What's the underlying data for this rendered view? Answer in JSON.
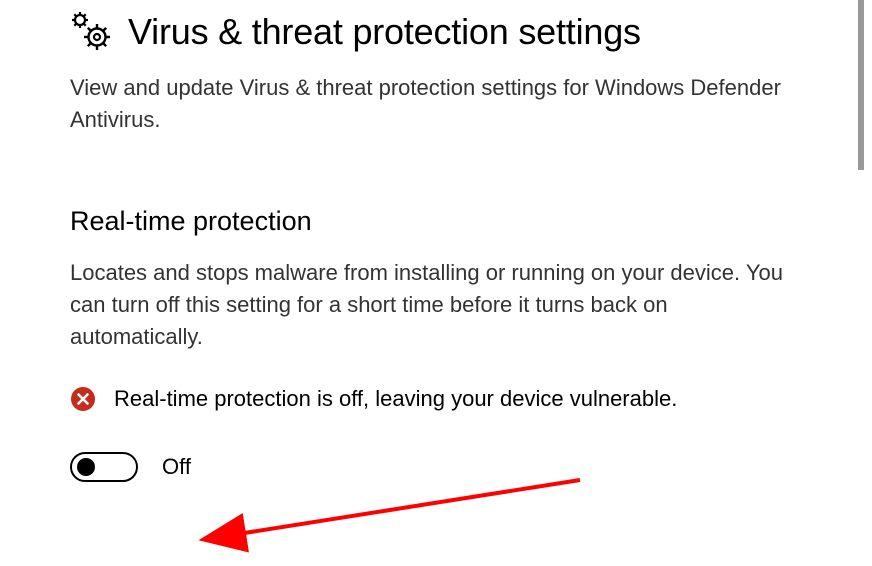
{
  "header": {
    "title": "Virus & threat protection settings",
    "description": "View and update Virus & threat protection settings for Windows Defender Antivirus."
  },
  "section": {
    "title": "Real-time protection",
    "description": "Locates and stops malware from installing or running on your device. You can turn off this setting for a short time before it turns back on automatically.",
    "warning": "Real-time protection is off, leaving your device vulnerable.",
    "toggle_label": "Off"
  },
  "colors": {
    "error": "#C42B1C",
    "arrow": "#FF0000"
  }
}
